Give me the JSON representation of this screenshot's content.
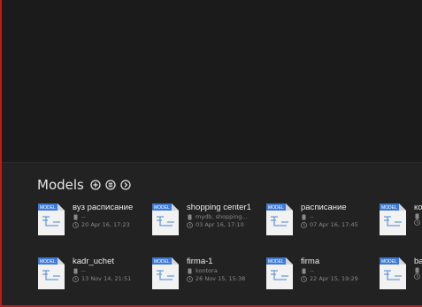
{
  "section": {
    "title": "Models",
    "icons": [
      "add-circle-icon",
      "database-circle-icon",
      "arrow-right-circle-icon"
    ]
  },
  "doc_badge": "MODEL",
  "cards": [
    {
      "name": "вуз расписание",
      "db": "--",
      "date": "20 Apr 16, 17:23"
    },
    {
      "name": "shopping center1",
      "db": "mydb, shopping...",
      "date": "03 Apr 16, 17:10"
    },
    {
      "name": "расписание",
      "db": "--",
      "date": "07 Apr 16, 17:45"
    },
    {
      "name": "ко",
      "db": "",
      "date": ""
    },
    {
      "name": "kadr_uchet",
      "db": "--",
      "date": "13 Nov 14, 21:51"
    },
    {
      "name": "firma-1",
      "db": "kontora",
      "date": "26 Nov 15, 15:38"
    },
    {
      "name": "firma",
      "db": "--",
      "date": "22 Apr 15, 19:29"
    },
    {
      "name": "ba",
      "db": "",
      "date": ""
    }
  ]
}
